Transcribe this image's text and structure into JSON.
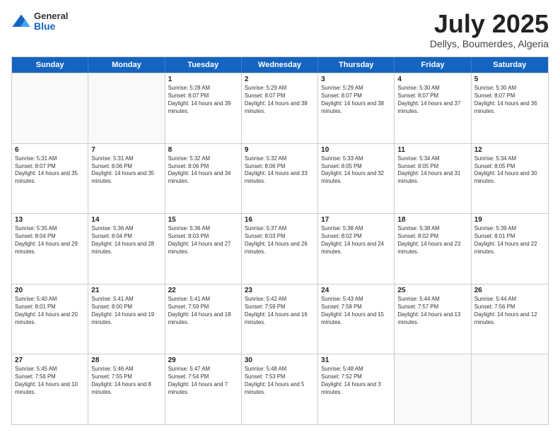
{
  "header": {
    "logo_general": "General",
    "logo_blue": "Blue",
    "month": "July 2025",
    "location": "Dellys, Boumerdes, Algeria"
  },
  "days_of_week": [
    "Sunday",
    "Monday",
    "Tuesday",
    "Wednesday",
    "Thursday",
    "Friday",
    "Saturday"
  ],
  "weeks": [
    [
      {
        "day": "",
        "sunrise": "",
        "sunset": "",
        "daylight": ""
      },
      {
        "day": "",
        "sunrise": "",
        "sunset": "",
        "daylight": ""
      },
      {
        "day": "1",
        "sunrise": "Sunrise: 5:28 AM",
        "sunset": "Sunset: 8:07 PM",
        "daylight": "Daylight: 14 hours and 39 minutes."
      },
      {
        "day": "2",
        "sunrise": "Sunrise: 5:29 AM",
        "sunset": "Sunset: 8:07 PM",
        "daylight": "Daylight: 14 hours and 38 minutes."
      },
      {
        "day": "3",
        "sunrise": "Sunrise: 5:29 AM",
        "sunset": "Sunset: 8:07 PM",
        "daylight": "Daylight: 14 hours and 38 minutes."
      },
      {
        "day": "4",
        "sunrise": "Sunrise: 5:30 AM",
        "sunset": "Sunset: 8:07 PM",
        "daylight": "Daylight: 14 hours and 37 minutes."
      },
      {
        "day": "5",
        "sunrise": "Sunrise: 5:30 AM",
        "sunset": "Sunset: 8:07 PM",
        "daylight": "Daylight: 14 hours and 36 minutes."
      }
    ],
    [
      {
        "day": "6",
        "sunrise": "Sunrise: 5:31 AM",
        "sunset": "Sunset: 8:07 PM",
        "daylight": "Daylight: 14 hours and 35 minutes."
      },
      {
        "day": "7",
        "sunrise": "Sunrise: 5:31 AM",
        "sunset": "Sunset: 8:06 PM",
        "daylight": "Daylight: 14 hours and 35 minutes."
      },
      {
        "day": "8",
        "sunrise": "Sunrise: 5:32 AM",
        "sunset": "Sunset: 8:06 PM",
        "daylight": "Daylight: 14 hours and 34 minutes."
      },
      {
        "day": "9",
        "sunrise": "Sunrise: 5:32 AM",
        "sunset": "Sunset: 8:06 PM",
        "daylight": "Daylight: 14 hours and 33 minutes."
      },
      {
        "day": "10",
        "sunrise": "Sunrise: 5:33 AM",
        "sunset": "Sunset: 8:05 PM",
        "daylight": "Daylight: 14 hours and 32 minutes."
      },
      {
        "day": "11",
        "sunrise": "Sunrise: 5:34 AM",
        "sunset": "Sunset: 8:05 PM",
        "daylight": "Daylight: 14 hours and 31 minutes."
      },
      {
        "day": "12",
        "sunrise": "Sunrise: 5:34 AM",
        "sunset": "Sunset: 8:05 PM",
        "daylight": "Daylight: 14 hours and 30 minutes."
      }
    ],
    [
      {
        "day": "13",
        "sunrise": "Sunrise: 5:35 AM",
        "sunset": "Sunset: 8:04 PM",
        "daylight": "Daylight: 14 hours and 29 minutes."
      },
      {
        "day": "14",
        "sunrise": "Sunrise: 5:36 AM",
        "sunset": "Sunset: 8:04 PM",
        "daylight": "Daylight: 14 hours and 28 minutes."
      },
      {
        "day": "15",
        "sunrise": "Sunrise: 5:36 AM",
        "sunset": "Sunset: 8:03 PM",
        "daylight": "Daylight: 14 hours and 27 minutes."
      },
      {
        "day": "16",
        "sunrise": "Sunrise: 5:37 AM",
        "sunset": "Sunset: 8:03 PM",
        "daylight": "Daylight: 14 hours and 26 minutes."
      },
      {
        "day": "17",
        "sunrise": "Sunrise: 5:38 AM",
        "sunset": "Sunset: 8:02 PM",
        "daylight": "Daylight: 14 hours and 24 minutes."
      },
      {
        "day": "18",
        "sunrise": "Sunrise: 5:38 AM",
        "sunset": "Sunset: 8:02 PM",
        "daylight": "Daylight: 14 hours and 23 minutes."
      },
      {
        "day": "19",
        "sunrise": "Sunrise: 5:39 AM",
        "sunset": "Sunset: 8:01 PM",
        "daylight": "Daylight: 14 hours and 22 minutes."
      }
    ],
    [
      {
        "day": "20",
        "sunrise": "Sunrise: 5:40 AM",
        "sunset": "Sunset: 8:01 PM",
        "daylight": "Daylight: 14 hours and 20 minutes."
      },
      {
        "day": "21",
        "sunrise": "Sunrise: 5:41 AM",
        "sunset": "Sunset: 8:00 PM",
        "daylight": "Daylight: 14 hours and 19 minutes."
      },
      {
        "day": "22",
        "sunrise": "Sunrise: 5:41 AM",
        "sunset": "Sunset: 7:59 PM",
        "daylight": "Daylight: 14 hours and 18 minutes."
      },
      {
        "day": "23",
        "sunrise": "Sunrise: 5:42 AM",
        "sunset": "Sunset: 7:59 PM",
        "daylight": "Daylight: 14 hours and 16 minutes."
      },
      {
        "day": "24",
        "sunrise": "Sunrise: 5:43 AM",
        "sunset": "Sunset: 7:58 PM",
        "daylight": "Daylight: 14 hours and 15 minutes."
      },
      {
        "day": "25",
        "sunrise": "Sunrise: 5:44 AM",
        "sunset": "Sunset: 7:57 PM",
        "daylight": "Daylight: 14 hours and 13 minutes."
      },
      {
        "day": "26",
        "sunrise": "Sunrise: 5:44 AM",
        "sunset": "Sunset: 7:56 PM",
        "daylight": "Daylight: 14 hours and 12 minutes."
      }
    ],
    [
      {
        "day": "27",
        "sunrise": "Sunrise: 5:45 AM",
        "sunset": "Sunset: 7:56 PM",
        "daylight": "Daylight: 14 hours and 10 minutes."
      },
      {
        "day": "28",
        "sunrise": "Sunrise: 5:46 AM",
        "sunset": "Sunset: 7:55 PM",
        "daylight": "Daylight: 14 hours and 8 minutes."
      },
      {
        "day": "29",
        "sunrise": "Sunrise: 5:47 AM",
        "sunset": "Sunset: 7:54 PM",
        "daylight": "Daylight: 14 hours and 7 minutes."
      },
      {
        "day": "30",
        "sunrise": "Sunrise: 5:48 AM",
        "sunset": "Sunset: 7:53 PM",
        "daylight": "Daylight: 14 hours and 5 minutes."
      },
      {
        "day": "31",
        "sunrise": "Sunrise: 5:48 AM",
        "sunset": "Sunset: 7:52 PM",
        "daylight": "Daylight: 14 hours and 3 minutes."
      },
      {
        "day": "",
        "sunrise": "",
        "sunset": "",
        "daylight": ""
      },
      {
        "day": "",
        "sunrise": "",
        "sunset": "",
        "daylight": ""
      }
    ]
  ]
}
